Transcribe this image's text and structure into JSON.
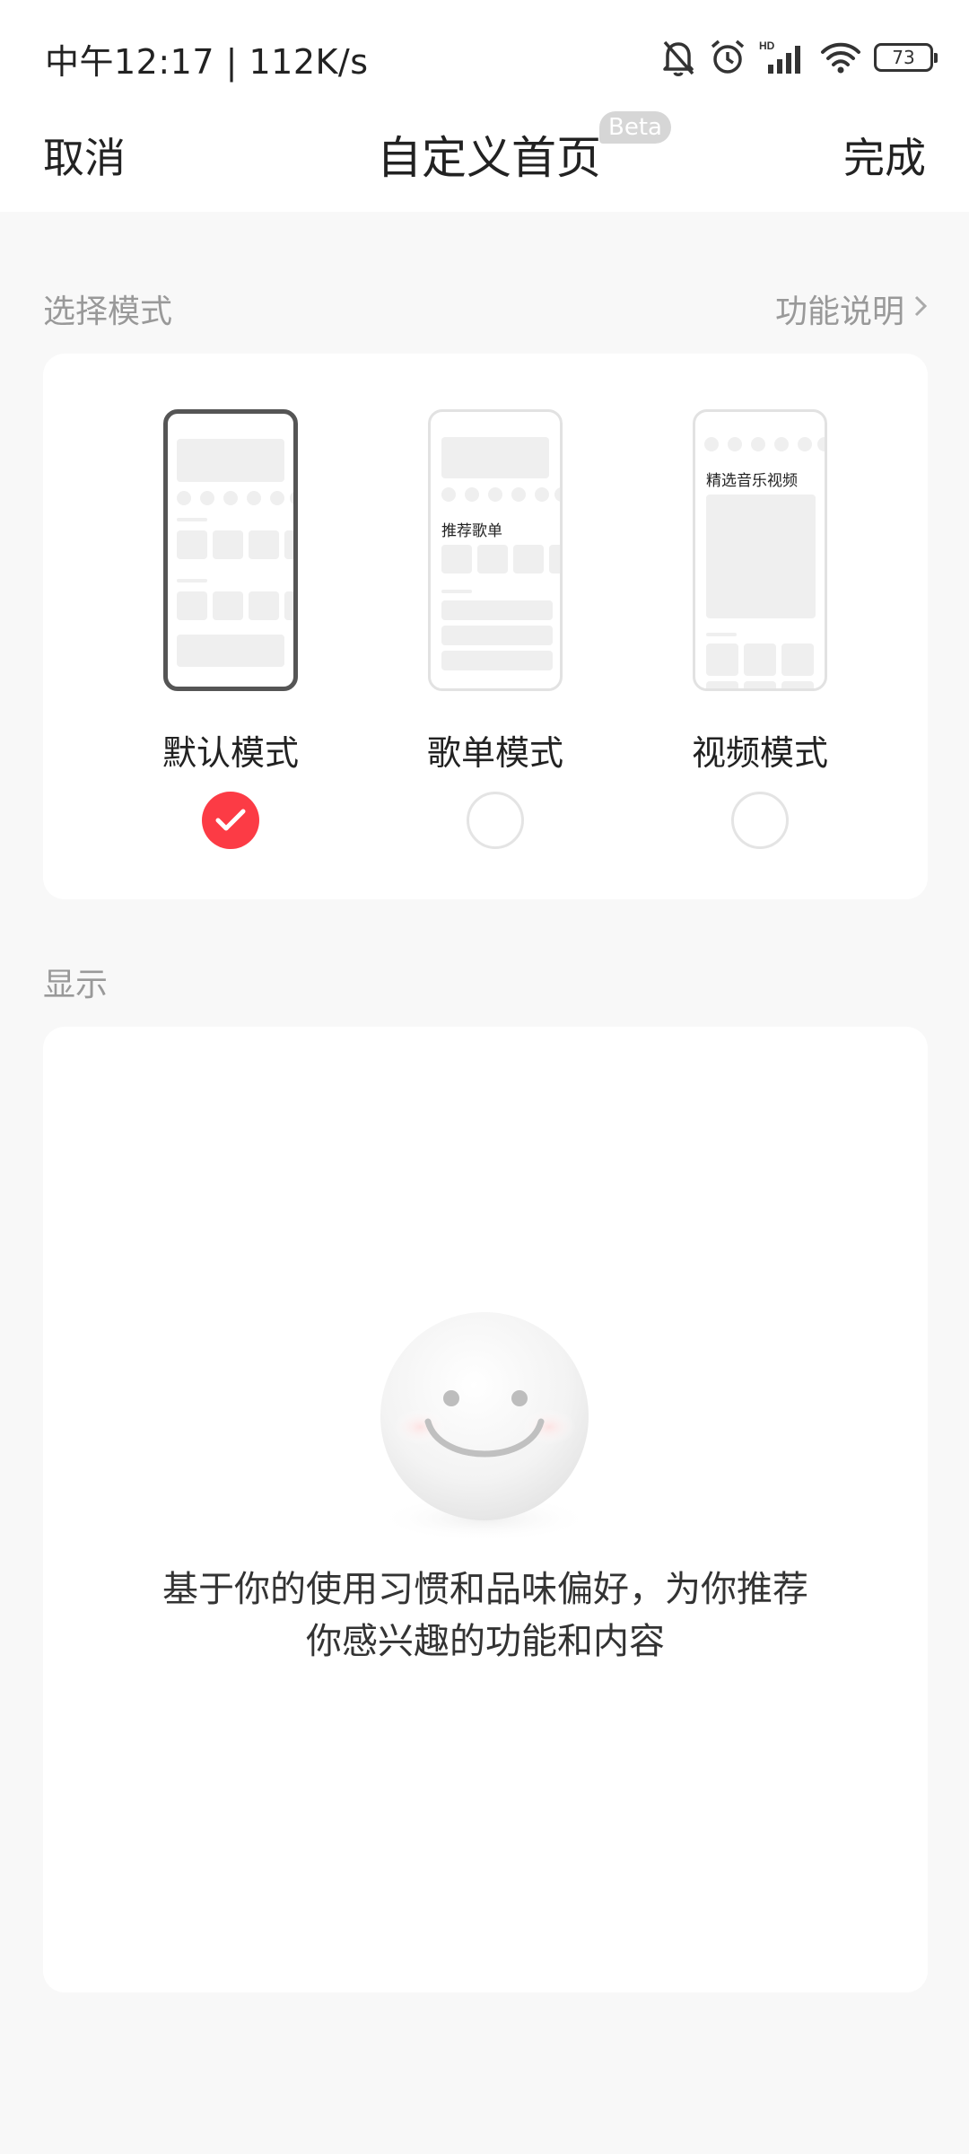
{
  "status_bar": {
    "time": "中午12:17 | 112K/s",
    "battery": "73",
    "icons": [
      "bell-off-icon",
      "alarm-icon",
      "hd-signal-icon",
      "wifi-icon",
      "battery-icon"
    ]
  },
  "nav": {
    "cancel": "取消",
    "title": "自定义首页",
    "beta": "Beta",
    "done": "完成"
  },
  "mode_section": {
    "label": "选择模式",
    "help_link": "功能说明",
    "modes": [
      {
        "name": "默认模式",
        "selected": true
      },
      {
        "name": "歌单模式",
        "selected": false,
        "preview_label": "推荐歌单"
      },
      {
        "name": "视频模式",
        "selected": false,
        "preview_label": "精选音乐视频"
      }
    ]
  },
  "display_section": {
    "label": "显示",
    "empty_line1": "基于你的使用习惯和品味偏好，为你推荐",
    "empty_line2": "你感兴趣的功能和内容"
  },
  "colors": {
    "accent": "#fc3b45",
    "background": "#f8f8f8",
    "card": "#ffffff",
    "muted_text": "#999999"
  }
}
